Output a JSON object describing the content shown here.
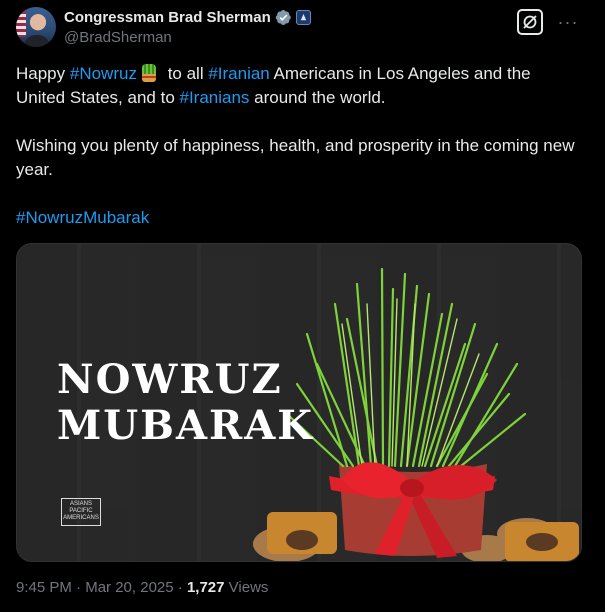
{
  "author": {
    "display_name": "Congressman Brad Sherman",
    "handle": "@BradSherman",
    "verified_icon": "verified-badge-icon",
    "affiliation_icon": "government-affiliation-icon"
  },
  "actions": {
    "grok_icon": "grok-icon",
    "more_label": "···"
  },
  "post": {
    "line1_prefix": "Happy ",
    "hashtag_nowruz": "#Nowruz",
    "emoji_icon": "sabzeh-emoji-icon",
    "line1_mid": " to all ",
    "hashtag_iranian": "#Iranian",
    "line1_suffix": " Americans in Los Angeles and the United States, and to ",
    "hashtag_iranians": "#Iranians",
    "line1_end": " around the world.",
    "paragraph2": "Wishing you plenty of happiness, health, and prosperity in the coming new year.",
    "hashtag_mubarak": "#NowruzMubarak"
  },
  "media": {
    "title_line1": "NOWRUZ",
    "title_line2": "MUBARAK",
    "logo_line1": "ASIANS",
    "logo_line2": "PACIFIC",
    "logo_line3": "AMERICANS"
  },
  "meta": {
    "time": "9:45 PM",
    "separator": " · ",
    "date": "Mar 20, 2025",
    "views_count": "1,727",
    "views_label": " Views"
  },
  "colors": {
    "background": "#000000",
    "text": "#e7e9ea",
    "muted": "#71767b",
    "link": "#1d9bf0"
  }
}
